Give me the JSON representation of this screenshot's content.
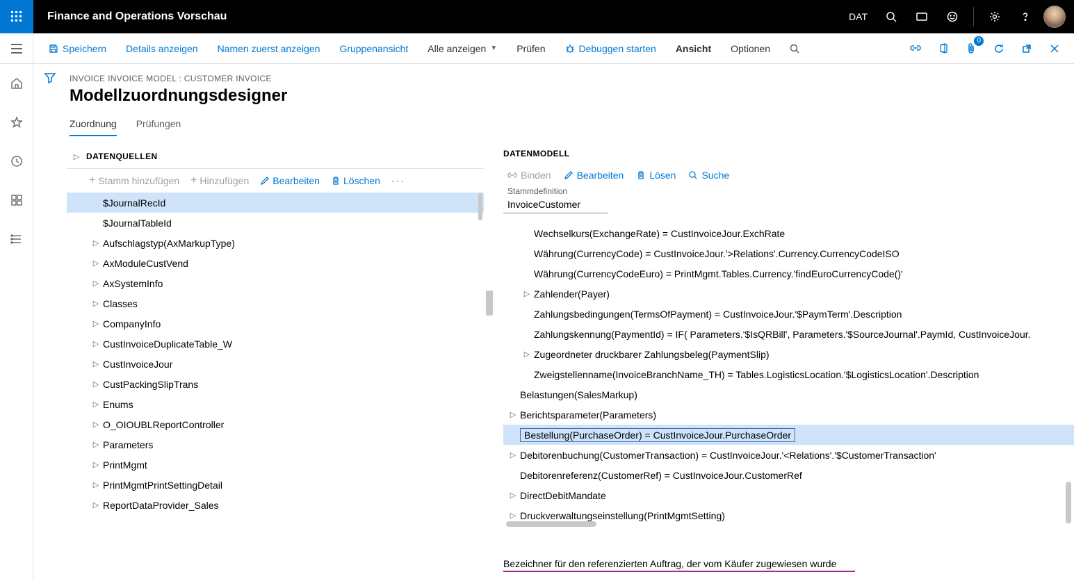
{
  "topbar": {
    "title": "Finance and Operations Vorschau",
    "company": "DAT"
  },
  "cmdbar": {
    "save": "Speichern",
    "details": "Details anzeigen",
    "names_first": "Namen zuerst anzeigen",
    "group_view": "Gruppenansicht",
    "show_all": "Alle anzeigen",
    "validate": "Prüfen",
    "debug": "Debuggen starten",
    "view": "Ansicht",
    "options": "Optionen",
    "badge_count": "0"
  },
  "page": {
    "breadcrumb": "INVOICE INVOICE MODEL : CUSTOMER INVOICE",
    "title": "Modellzuordnungsdesigner",
    "tabs": [
      "Zuordnung",
      "Prüfungen"
    ]
  },
  "left_pane": {
    "title": "DATENQUELLEN",
    "toolbar": {
      "add_root": "Stamm hinzufügen",
      "add": "Hinzufügen",
      "edit": "Bearbeiten",
      "delete": "Löschen"
    },
    "tree": [
      {
        "label": "$JournalRecId",
        "expandable": false,
        "selected": true
      },
      {
        "label": "$JournalTableId",
        "expandable": false
      },
      {
        "label": "Aufschlagstyp(AxMarkupType)",
        "expandable": true
      },
      {
        "label": "AxModuleCustVend",
        "expandable": true
      },
      {
        "label": "AxSystemInfo",
        "expandable": true
      },
      {
        "label": "Classes",
        "expandable": true
      },
      {
        "label": "CompanyInfo",
        "expandable": true
      },
      {
        "label": "CustInvoiceDuplicateTable_W",
        "expandable": true
      },
      {
        "label": "CustInvoiceJour",
        "expandable": true
      },
      {
        "label": "CustPackingSlipTrans",
        "expandable": true
      },
      {
        "label": "Enums",
        "expandable": true
      },
      {
        "label": "O_OIOUBLReportController",
        "expandable": true
      },
      {
        "label": "Parameters",
        "expandable": true
      },
      {
        "label": "PrintMgmt",
        "expandable": true
      },
      {
        "label": "PrintMgmtPrintSettingDetail",
        "expandable": true
      },
      {
        "label": "ReportDataProvider_Sales",
        "expandable": true
      }
    ]
  },
  "right_pane": {
    "title": "DATENMODELL",
    "toolbar": {
      "bind": "Binden",
      "edit": "Bearbeiten",
      "delete": "Lösen",
      "search": "Suche"
    },
    "root_label": "Stammdefinition",
    "root_value": "InvoiceCustomer",
    "tree": [
      {
        "label": "Wechselkurs(ExchangeRate) = CustInvoiceJour.ExchRate",
        "indent": 1,
        "expandable": false
      },
      {
        "label": "Währung(CurrencyCode) = CustInvoiceJour.'>Relations'.Currency.CurrencyCodeISO",
        "indent": 1,
        "expandable": false
      },
      {
        "label": "Währung(CurrencyCodeEuro) = PrintMgmt.Tables.Currency.'findEuroCurrencyCode()'",
        "indent": 1,
        "expandable": false
      },
      {
        "label": "Zahlender(Payer)",
        "indent": 1,
        "expandable": true
      },
      {
        "label": "Zahlungsbedingungen(TermsOfPayment) = CustInvoiceJour.'$PaymTerm'.Description",
        "indent": 1,
        "expandable": false
      },
      {
        "label": "Zahlungskennung(PaymentId) = IF( Parameters.'$IsQRBill', Parameters.'$SourceJournal'.PaymId, CustInvoiceJour.",
        "indent": 1,
        "expandable": false
      },
      {
        "label": "Zugeordneter druckbarer Zahlungsbeleg(PaymentSlip)",
        "indent": 1,
        "expandable": true
      },
      {
        "label": "Zweigstellenname(InvoiceBranchName_TH) = Tables.LogisticsLocation.'$LogisticsLocation'.Description",
        "indent": 1,
        "expandable": false
      },
      {
        "label": "Belastungen(SalesMarkup)",
        "indent": 0,
        "expandable": false
      },
      {
        "label": "Berichtsparameter(Parameters)",
        "indent": 0,
        "expandable": true
      },
      {
        "label": "Bestellung(PurchaseOrder) = CustInvoiceJour.PurchaseOrder",
        "indent": 0,
        "expandable": false,
        "selected": true
      },
      {
        "label": "Debitorenbuchung(CustomerTransaction) = CustInvoiceJour.'<Relations'.'$CustomerTransaction'",
        "indent": 0,
        "expandable": true
      },
      {
        "label": "Debitorenreferenz(CustomerRef) = CustInvoiceJour.CustomerRef",
        "indent": 0,
        "expandable": false
      },
      {
        "label": "DirectDebitMandate",
        "indent": 0,
        "expandable": true
      },
      {
        "label": "Druckverwaltungseinstellung(PrintMgmtSetting)",
        "indent": 0,
        "expandable": true
      }
    ],
    "footer": "Bezeichner für den referenzierten Auftrag, der vom Käufer zugewiesen wurde"
  }
}
